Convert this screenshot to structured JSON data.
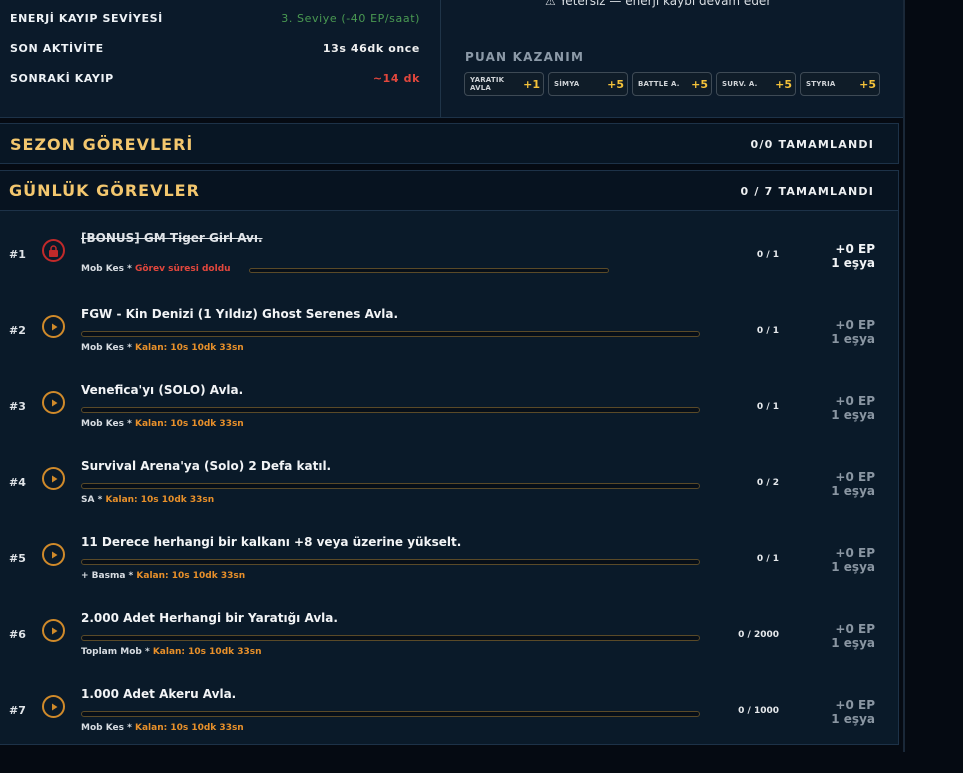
{
  "energy": {
    "rows": [
      {
        "label": "ENERJİ KAYIP SEVİYESİ",
        "value": "3. Seviye (-40 EP/saat)",
        "tone": "green"
      },
      {
        "label": "SON AKTİVİTE",
        "value": "13s 46dk once",
        "tone": "white"
      },
      {
        "label": "SONRAKİ KAYIP",
        "value": "~14 dk",
        "tone": "red"
      }
    ],
    "warning_text": "⚠ Yetersiz — enerji kaybı devam eder"
  },
  "puan": {
    "title": "PUAN KAZANIM",
    "buttons": [
      {
        "label": "YARATIK AVLA",
        "value": "+1"
      },
      {
        "label": "SİMYA",
        "value": "+5"
      },
      {
        "label": "BATTLE A.",
        "value": "+5"
      },
      {
        "label": "SURV. A.",
        "value": "+5"
      },
      {
        "label": "STYRIA",
        "value": "+5"
      }
    ]
  },
  "sezon": {
    "title": "SEZON GÖREVLERİ",
    "count": "0/0 TAMAMLANDI"
  },
  "gunluk": {
    "title": "GÜNLÜK GÖREVLER",
    "count": "0 / 7 TAMAMLANDI",
    "quests": [
      {
        "num": "#1",
        "title": "[BONUS] GM Tiger Girl Avı.",
        "category": "Mob Kes *",
        "status": "Görev süresi doldu",
        "progress": "0 / 1",
        "ep": "+0 EP",
        "items": "1 eşya",
        "locked": true
      },
      {
        "num": "#2",
        "title": "FGW - Kin Denizi (1 Yıldız) Ghost Serenes Avla.",
        "category": "Mob Kes *",
        "status": "Kalan: 10s 10dk 33sn",
        "progress": "0 / 1",
        "ep": "+0 EP",
        "items": "1 eşya",
        "locked": false
      },
      {
        "num": "#3",
        "title": "Venefica'yı (SOLO) Avla.",
        "category": "Mob Kes *",
        "status": "Kalan: 10s 10dk 33sn",
        "progress": "0 / 1",
        "ep": "+0 EP",
        "items": "1 eşya",
        "locked": false
      },
      {
        "num": "#4",
        "title": "Survival Arena'ya (Solo) 2 Defa katıl.",
        "category": "SA *",
        "status": "Kalan: 10s 10dk 33sn",
        "progress": "0 / 2",
        "ep": "+0 EP",
        "items": "1 eşya",
        "locked": false
      },
      {
        "num": "#5",
        "title": "11 Derece herhangi bir kalkanı +8 veya üzerine yükselt.",
        "category": "+ Basma *",
        "status": "Kalan: 10s 10dk 33sn",
        "progress": "0 / 1",
        "ep": "+0 EP",
        "items": "1 eşya",
        "locked": false
      },
      {
        "num": "#6",
        "title": "2.000 Adet Herhangi bir Yaratığı Avla.",
        "category": "Toplam Mob *",
        "status": "Kalan: 10s 10dk 33sn",
        "progress": "0 / 2000",
        "ep": "+0 EP",
        "items": "1 eşya",
        "locked": false
      },
      {
        "num": "#7",
        "title": "1.000 Adet Akeru Avla.",
        "category": "Mob Kes *",
        "status": "Kalan: 10s 10dk 33sn",
        "progress": "0 / 1000",
        "ep": "+0 EP",
        "items": "1 eşya",
        "locked": false
      }
    ]
  }
}
